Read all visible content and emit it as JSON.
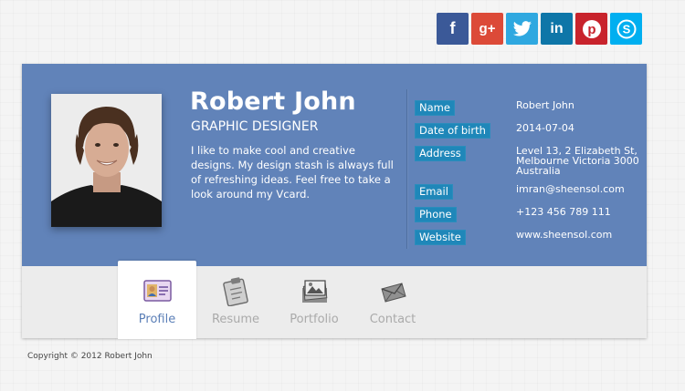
{
  "social": [
    {
      "name": "facebook",
      "glyph": "f",
      "color": "#3b5998"
    },
    {
      "name": "google-plus",
      "glyph": "g+",
      "color": "#dc4a38"
    },
    {
      "name": "twitter",
      "glyph": "t",
      "color": "#2fa8e0"
    },
    {
      "name": "linkedin",
      "glyph": "in",
      "color": "#0e76a8"
    },
    {
      "name": "pinterest",
      "glyph": "p",
      "color": "#c8232c"
    },
    {
      "name": "skype",
      "glyph": "S",
      "color": "#00aff0"
    }
  ],
  "profile": {
    "name": "Robert John",
    "role": "GRAPHIC DESIGNER",
    "bio": "I like to make cool and creative designs. My design stash is always full of refreshing ideas. Feel free to take a look around my Vcard."
  },
  "info": [
    {
      "label": "Name",
      "value": "Robert John"
    },
    {
      "label": "Date of birth",
      "value": "2014-07-04"
    },
    {
      "label": "Address",
      "value": "Level 13, 2 Elizabeth St, Melbourne Victoria 3000 Australia"
    },
    {
      "label": "Email",
      "value": "imran@sheensol.com"
    },
    {
      "label": "Phone",
      "value": "+123 456 789 111"
    },
    {
      "label": "Website",
      "value": "www.sheensol.com"
    }
  ],
  "tabs": [
    {
      "label": "Profile",
      "icon": "id-card-icon",
      "active": true
    },
    {
      "label": "Resume",
      "icon": "clipboard-icon",
      "active": false
    },
    {
      "label": "Portfolio",
      "icon": "photo-stack-icon",
      "active": false
    },
    {
      "label": "Contact",
      "icon": "mail-icon",
      "active": false
    }
  ],
  "footer": {
    "copyright": "Copyright © 2012 Robert John"
  },
  "colors": {
    "card": "#6183b9",
    "label": "#1f87b9",
    "active_tab_text": "#5b7fb7"
  }
}
